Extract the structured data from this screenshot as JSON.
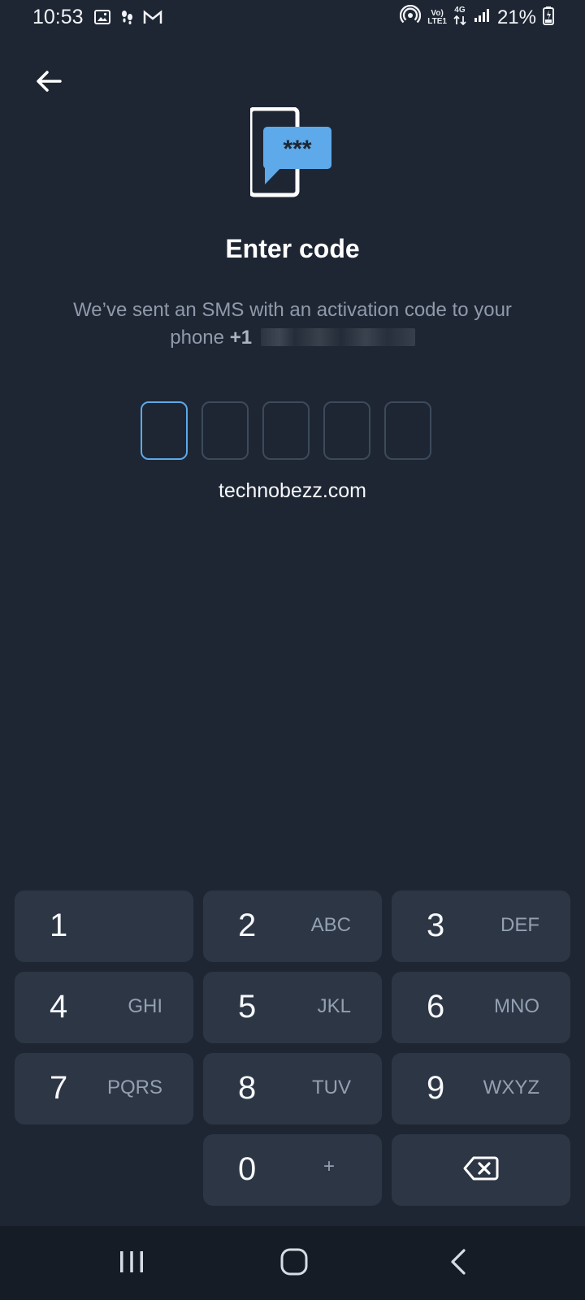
{
  "status_bar": {
    "time": "10:53",
    "battery": "21%",
    "icons": [
      "image-icon",
      "walking-icon",
      "gmail-icon",
      "hotspot-icon",
      "volte-icon",
      "4g-icon",
      "signal-icon",
      "battery-icon"
    ],
    "volte_top": "Vo)",
    "volte_bottom": "LTE1",
    "network_label": "4G"
  },
  "header": {
    "back_icon": "arrow-left-icon",
    "hero_icon": "sms-code-icon",
    "hero_text": "***",
    "title": "Enter code",
    "subtitle_prefix": "We’ve sent an SMS with an activation code to your",
    "subtitle_phone_label": "phone",
    "phone_prefix": "+1"
  },
  "code_input": {
    "length": 5,
    "values": [
      "",
      "",
      "",
      "",
      ""
    ]
  },
  "watermark": {
    "text": "technobezz.com"
  },
  "keypad": {
    "keys": [
      {
        "digit": "1",
        "letters": ""
      },
      {
        "digit": "2",
        "letters": "ABC"
      },
      {
        "digit": "3",
        "letters": "DEF"
      },
      {
        "digit": "4",
        "letters": "GHI"
      },
      {
        "digit": "5",
        "letters": "JKL"
      },
      {
        "digit": "6",
        "letters": "MNO"
      },
      {
        "digit": "7",
        "letters": "PQRS"
      },
      {
        "digit": "8",
        "letters": "TUV"
      },
      {
        "digit": "9",
        "letters": "WXYZ"
      },
      {
        "digit": "0",
        "letters": "+"
      }
    ],
    "backspace_icon": "backspace-icon"
  },
  "navigation": {
    "recent_icon": "recent-apps-icon",
    "home_icon": "home-icon",
    "back_icon": "back-icon"
  },
  "colors": {
    "background": "#1e2633",
    "key_background": "#2d3644",
    "accent": "#5da9e9",
    "muted_text": "#8f9aab"
  }
}
